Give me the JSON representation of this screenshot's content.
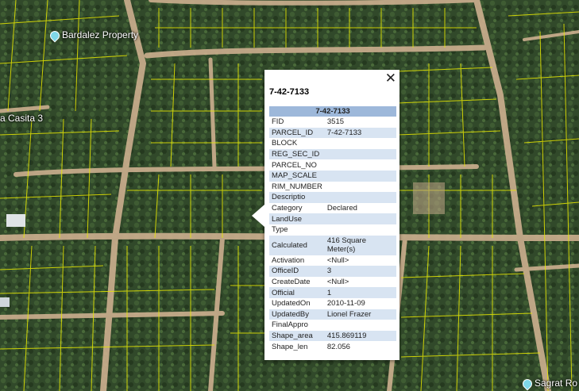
{
  "places": [
    {
      "name": "Bardalez Property",
      "pin": true
    },
    {
      "name": "a Casita 3",
      "pin": false
    },
    {
      "name": "Sagrat Ro",
      "pin": true
    }
  ],
  "popup": {
    "title": "7-42-7133",
    "close_label": "✕",
    "table_header": "7-42-7133",
    "rows": [
      {
        "key": "FID",
        "value": "3515"
      },
      {
        "key": "PARCEL_ID",
        "value": "7-42-7133"
      },
      {
        "key": "BLOCK",
        "value": ""
      },
      {
        "key": "REG_SEC_ID",
        "value": ""
      },
      {
        "key": "PARCEL_NO",
        "value": ""
      },
      {
        "key": "MAP_SCALE",
        "value": ""
      },
      {
        "key": "RIM_NUMBER",
        "value": ""
      },
      {
        "key": "Descriptio",
        "value": ""
      },
      {
        "key": "Category",
        "value": "Declared"
      },
      {
        "key": "LandUse",
        "value": ""
      },
      {
        "key": "Type",
        "value": ""
      },
      {
        "key": "Calculated",
        "value": "416 Square Meter(s)"
      },
      {
        "key": "Activation",
        "value": "<Null>"
      },
      {
        "key": "OfficeID",
        "value": "3"
      },
      {
        "key": "CreateDate",
        "value": "<Null>"
      },
      {
        "key": "Official",
        "value": "1"
      },
      {
        "key": "UpdatedOn",
        "value": "2010-11-09"
      },
      {
        "key": "UpdatedBy",
        "value": "Lionel Frazer"
      },
      {
        "key": "FinalAppro",
        "value": ""
      },
      {
        "key": "Shape_area",
        "value": "415.869119"
      },
      {
        "key": "Shape_len",
        "value": "82.056"
      }
    ]
  },
  "colors": {
    "parcel_lines": "#e8e800",
    "road": "#c8a882",
    "vegetation": "#2f4a22"
  }
}
